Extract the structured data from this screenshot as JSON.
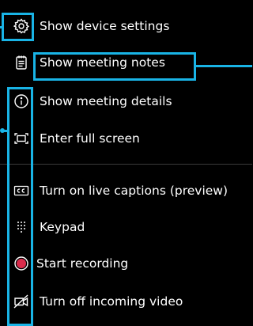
{
  "menu": {
    "items": [
      {
        "icon": "gear-icon",
        "label": "Show device settings"
      },
      {
        "icon": "notes-icon",
        "label": "Show meeting notes"
      },
      {
        "icon": "info-icon",
        "label": "Show meeting details"
      },
      {
        "icon": "fullscreen-icon",
        "label": "Enter full screen"
      },
      {
        "icon": "captions-icon",
        "label": "Turn on live captions (preview)"
      },
      {
        "icon": "keypad-icon",
        "label": "Keypad"
      },
      {
        "icon": "record-icon",
        "label": "Start recording"
      },
      {
        "icon": "video-off-icon",
        "label": "Turn off incoming video"
      }
    ]
  },
  "colors": {
    "background": "#000000",
    "text": "#ffffff",
    "callout": "#19b4e6",
    "record": "#d92c4b",
    "divider": "#3a3a3a"
  }
}
